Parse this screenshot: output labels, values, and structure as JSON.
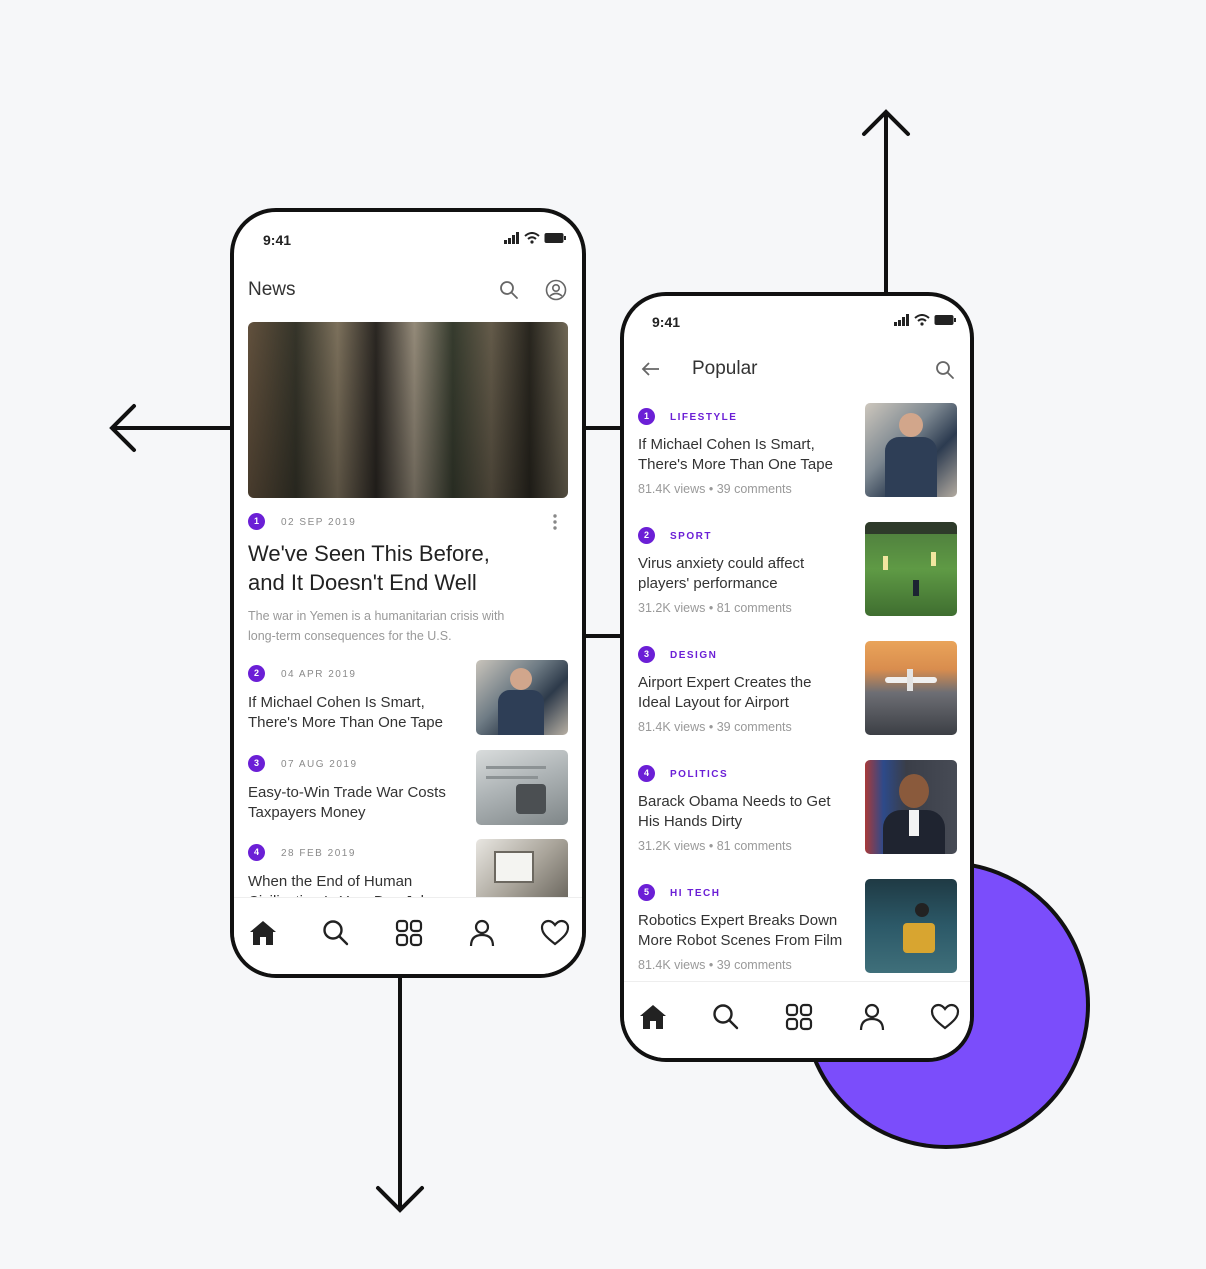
{
  "colors": {
    "accent": "#6b1fd6",
    "circle": "#7b4dfb",
    "background": "#f6f7f9"
  },
  "left_phone": {
    "status_time": "9:41",
    "title": "News",
    "hero": {
      "badge": "1",
      "date": "02 SEP 2019",
      "headline_line1": "We've Seen This Before,",
      "headline_line2": "and It Doesn't End Well",
      "summary_line1": "The war in Yemen is a humanitarian crisis with",
      "summary_line2": "long-term consequences for the U.S."
    },
    "articles": [
      {
        "badge": "2",
        "date": "04 APR 2019",
        "line1": "If Michael Cohen Is Smart,",
        "line2": "There's More Than One Tape"
      },
      {
        "badge": "3",
        "date": "07 AUG 2019",
        "line1": "Easy-to-Win Trade War Costs",
        "line2": "Taxpayers Money"
      },
      {
        "badge": "4",
        "date": "28 FEB 2019",
        "line1": "When the End of Human",
        "line2": "Civilization Is Your Day Job"
      }
    ],
    "nav": [
      "home-icon",
      "search-icon",
      "grid-icon",
      "profile-icon",
      "heart-icon"
    ]
  },
  "right_phone": {
    "status_time": "9:41",
    "title": "Popular",
    "articles": [
      {
        "badge": "1",
        "category": "LIFESTYLE",
        "line1": "If Michael Cohen Is Smart,",
        "line2": "There's More Than One Tape",
        "meta": "81.4K views • 39 comments"
      },
      {
        "badge": "2",
        "category": "SPORT",
        "line1": "Virus anxiety could affect",
        "line2": "players' performance",
        "meta": "31.2K views • 81 comments"
      },
      {
        "badge": "3",
        "category": "DESIGN",
        "line1": "Airport Expert Creates the",
        "line2": "Ideal Layout for Airport",
        "meta": "81.4K views • 39 comments"
      },
      {
        "badge": "4",
        "category": "POLITICS",
        "line1": "Barack Obama Needs to Get",
        "line2": "His Hands Dirty",
        "meta": "31.2K views • 81 comments"
      },
      {
        "badge": "5",
        "category": "HI TECH",
        "line1": "Robotics Expert Breaks Down",
        "line2": "More Robot Scenes From Film",
        "meta": "81.4K views • 39 comments"
      }
    ],
    "nav": [
      "home-icon",
      "search-icon",
      "grid-icon",
      "profile-icon",
      "heart-icon"
    ]
  }
}
